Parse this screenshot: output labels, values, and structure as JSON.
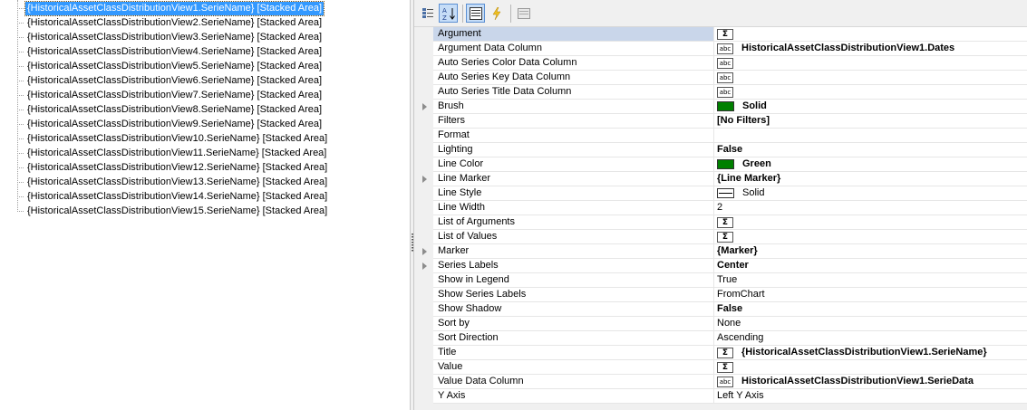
{
  "tree": {
    "selected_index": 0,
    "nodes": [
      "{HistoricalAssetClassDistributionView1.SerieName} [Stacked Area]",
      "{HistoricalAssetClassDistributionView2.SerieName} [Stacked Area]",
      "{HistoricalAssetClassDistributionView3.SerieName} [Stacked Area]",
      "{HistoricalAssetClassDistributionView4.SerieName} [Stacked Area]",
      "{HistoricalAssetClassDistributionView5.SerieName} [Stacked Area]",
      "{HistoricalAssetClassDistributionView6.SerieName} [Stacked Area]",
      "{HistoricalAssetClassDistributionView7.SerieName} [Stacked Area]",
      "{HistoricalAssetClassDistributionView8.SerieName} [Stacked Area]",
      "{HistoricalAssetClassDistributionView9.SerieName} [Stacked Area]",
      "{HistoricalAssetClassDistributionView10.SerieName} [Stacked Area]",
      "{HistoricalAssetClassDistributionView11.SerieName} [Stacked Area]",
      "{HistoricalAssetClassDistributionView12.SerieName} [Stacked Area]",
      "{HistoricalAssetClassDistributionView13.SerieName} [Stacked Area]",
      "{HistoricalAssetClassDistributionView14.SerieName} [Stacked Area]",
      "{HistoricalAssetClassDistributionView15.SerieName} [Stacked Area]"
    ]
  },
  "toolbar": {
    "buttons": [
      {
        "icon": "categorized-icon",
        "active": false
      },
      {
        "icon": "sort-alphabetical-icon",
        "active": true
      },
      {
        "icon": "properties-icon",
        "active": true
      },
      {
        "icon": "events-lightning-icon",
        "active": false
      },
      {
        "icon": "property-pages-icon",
        "active": false
      }
    ]
  },
  "colors": {
    "selection": "#3399ff",
    "green_swatch": "#008000",
    "grid_line": "#e6e6e6"
  },
  "properties": [
    {
      "name": "Argument",
      "value": "",
      "icon": "sigma",
      "selected": true
    },
    {
      "name": "Argument Data Column",
      "value": "HistoricalAssetClassDistributionView1.Dates",
      "icon": "abc",
      "bold": true
    },
    {
      "name": "Auto Series Color Data Column",
      "value": "",
      "icon": "abc"
    },
    {
      "name": "Auto Series Key Data Column",
      "value": "",
      "icon": "abc"
    },
    {
      "name": "Auto Series Title Data Column",
      "value": "",
      "icon": "abc"
    },
    {
      "name": "Brush",
      "value": "Solid",
      "swatch": "#008000",
      "bold": true,
      "expandable": true
    },
    {
      "name": "Filters",
      "value": "[No Filters]",
      "bold": true
    },
    {
      "name": "Format",
      "value": ""
    },
    {
      "name": "Lighting",
      "value": "False",
      "bold": true
    },
    {
      "name": "Line Color",
      "value": "Green",
      "swatch": "#008000",
      "bold": true
    },
    {
      "name": "Line Marker",
      "value": "{Line Marker}",
      "bold": true,
      "expandable": true
    },
    {
      "name": "Line Style",
      "value": "Solid",
      "icon": "linestyle"
    },
    {
      "name": "Line Width",
      "value": "2"
    },
    {
      "name": "List of Arguments",
      "value": "",
      "icon": "sigma"
    },
    {
      "name": "List of Values",
      "value": "",
      "icon": "sigma"
    },
    {
      "name": "Marker",
      "value": "{Marker}",
      "bold": true,
      "expandable": true
    },
    {
      "name": "Series Labels",
      "value": "Center",
      "bold": true,
      "expandable": true
    },
    {
      "name": "Show in Legend",
      "value": "True"
    },
    {
      "name": "Show Series Labels",
      "value": "FromChart"
    },
    {
      "name": "Show Shadow",
      "value": "False",
      "bold": true
    },
    {
      "name": "Sort by",
      "value": "None"
    },
    {
      "name": "Sort Direction",
      "value": "Ascending"
    },
    {
      "name": "Title",
      "value": "{HistoricalAssetClassDistributionView1.SerieName}",
      "icon": "sigma",
      "bold": true
    },
    {
      "name": "Value",
      "value": "",
      "icon": "sigma"
    },
    {
      "name": "Value Data Column",
      "value": "HistoricalAssetClassDistributionView1.SerieData",
      "icon": "abc",
      "bold": true
    },
    {
      "name": "Y Axis",
      "value": "Left Y Axis"
    }
  ]
}
